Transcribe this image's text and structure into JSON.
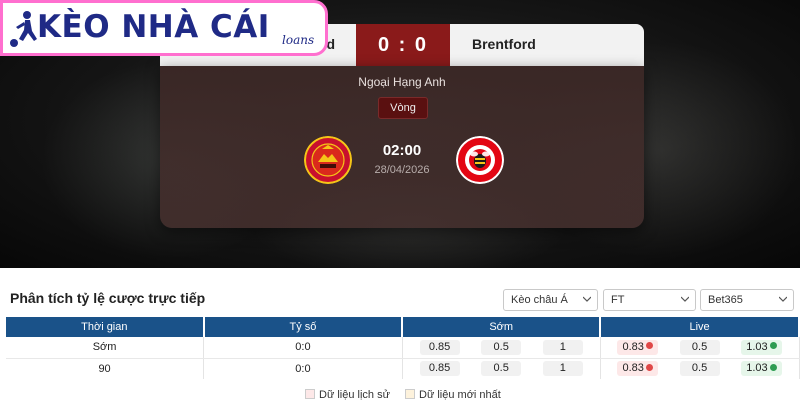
{
  "brand": {
    "title": "KÈO NHÀ CÁI",
    "subtitle": "loans"
  },
  "match": {
    "home_team": "Manchester United",
    "home_team_visible": "d",
    "away_team": "Brentford",
    "score": "0 : 0",
    "league": "Ngoại Hạng Anh",
    "round_label": "Vòng",
    "kickoff_time": "02:00",
    "kickoff_date": "28/04/2026",
    "home_logo_text": "MANCHESTER UNITED",
    "away_logo_text": "BRENTFORD"
  },
  "analysis": {
    "title": "Phân tích tỷ lệ cược trực tiếp",
    "filters": {
      "market": "Kèo châu Á",
      "period": "FT",
      "bookmaker": "Bet365"
    },
    "columns": [
      "Thời gian",
      "Tỷ số",
      "Sớm",
      "Live"
    ],
    "rows": [
      {
        "time": "Sớm",
        "score": "0:0",
        "early": [
          "0.85",
          "0.5",
          "1"
        ],
        "live": [
          "0.83",
          "0.5",
          "1.03"
        ]
      },
      {
        "time": "90",
        "score": "0:0",
        "early": [
          "0.85",
          "0.5",
          "1"
        ],
        "live": [
          "0.83",
          "0.5",
          "1.03"
        ]
      }
    ],
    "legend": [
      "Dữ liệu lịch sử",
      "Dữ liệu mới nhất"
    ]
  },
  "colors": {
    "score_box": "#8a1a1a",
    "table_header": "#1a5289",
    "brand_border": "#ff6fcf",
    "brand_text": "#1f2a86",
    "odds_down": "#e04848",
    "odds_up": "#2e9c52"
  }
}
